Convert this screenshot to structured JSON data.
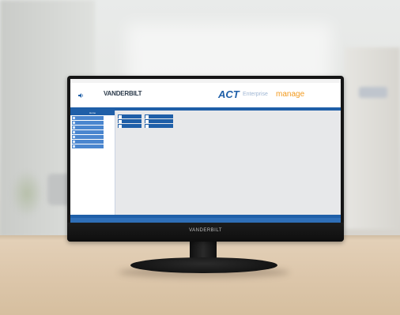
{
  "monitor": {
    "brand": "VANDERBILT"
  },
  "app": {
    "window_title": "ACT Enterprise",
    "brand_logo": "VANDERBILT",
    "product": {
      "act": "ACT",
      "enterprise": "Enterprise",
      "manage": "manage"
    },
    "sidebar_title": "Home",
    "colors": {
      "primary_blue": "#1f5fa8",
      "accent_orange": "#f29a1e",
      "alert_red": "#c8302b"
    }
  }
}
